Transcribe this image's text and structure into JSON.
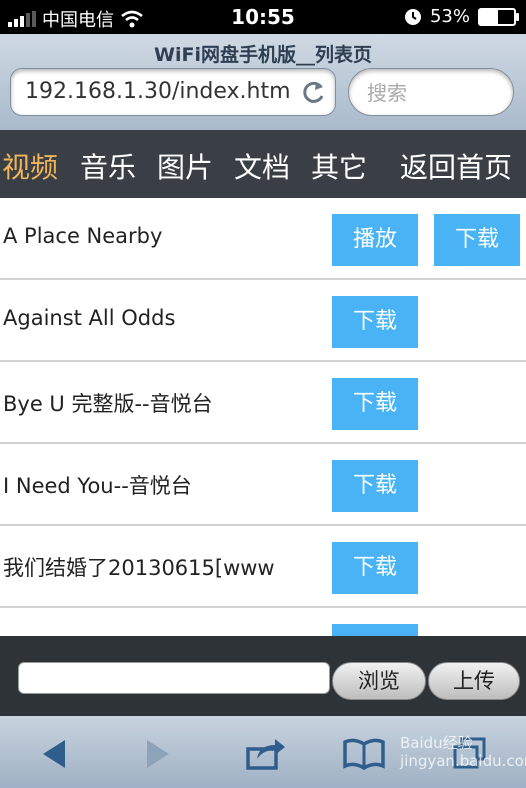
{
  "status_bar": {
    "carrier": "中国电信",
    "time": "10:55",
    "battery_percent": "53%",
    "battery_level": 0.53
  },
  "browser": {
    "page_title": "WiFi网盘手机版__列表页",
    "url": "192.168.1.30/index.html",
    "search_placeholder": "搜索"
  },
  "category_nav": {
    "items": [
      {
        "label": "视频",
        "active": true
      },
      {
        "label": "音乐"
      },
      {
        "label": "图片"
      },
      {
        "label": "文档"
      },
      {
        "label": "其它"
      }
    ],
    "home_label": "返回首页"
  },
  "file_list": {
    "play_label": "播放",
    "download_label": "下载",
    "items": [
      {
        "name": "A Place Nearby",
        "has_play": true
      },
      {
        "name": "Against All Odds"
      },
      {
        "name": "Bye U 完整版--音悦台"
      },
      {
        "name": "I Need You--音悦台"
      },
      {
        "name": "我们结婚了20130615[www"
      }
    ]
  },
  "upload_bar": {
    "browse_label": "浏览",
    "upload_label": "上传"
  },
  "toolbar": {
    "icons": [
      "back-icon",
      "forward-icon",
      "share-icon",
      "bookmarks-icon",
      "tabs-icon"
    ]
  },
  "watermark": {
    "line1": "Baidu经验",
    "line2": "jingyan.baidu.com"
  },
  "colors": {
    "accent_active": "#f0b45a",
    "button_blue": "#4ab3f5",
    "nav_bg": "#3a3f45"
  }
}
